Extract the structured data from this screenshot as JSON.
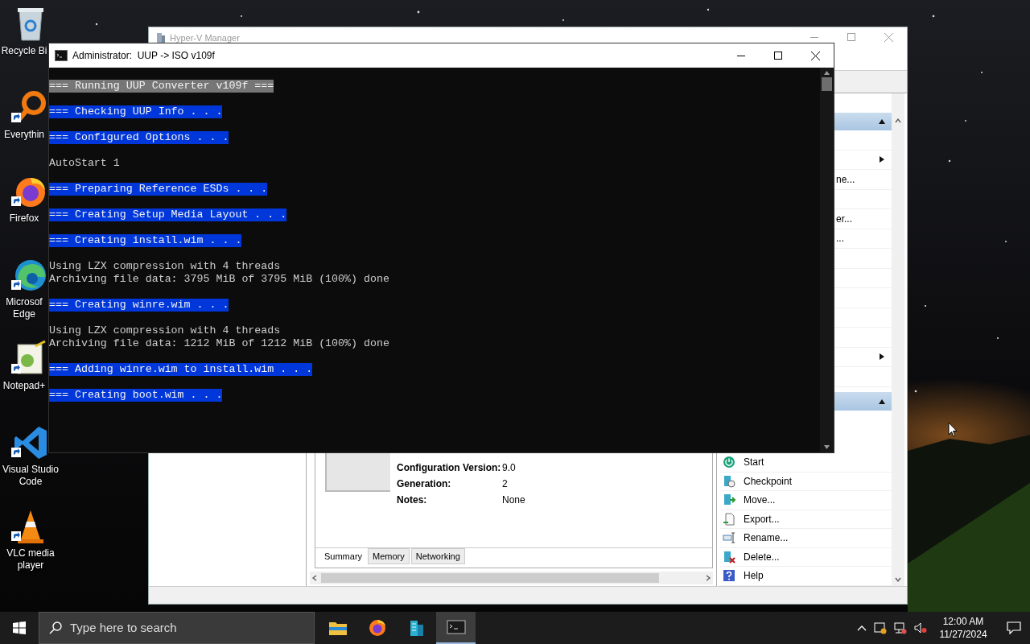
{
  "desktop_icons": [
    {
      "label": "Recycle Bi",
      "kind": "recycle-bin",
      "shortcut": false
    },
    {
      "label": "Everythin",
      "kind": "magnifier",
      "shortcut": true
    },
    {
      "label": "Firefox",
      "kind": "firefox",
      "shortcut": true
    },
    {
      "label": "Microsof Edge",
      "kind": "edge",
      "shortcut": true
    },
    {
      "label": "Notepad+",
      "kind": "notepad",
      "shortcut": true
    },
    {
      "label": "Visual Studio Code",
      "kind": "vscode",
      "shortcut": true
    },
    {
      "label": "VLC media player",
      "kind": "vlc",
      "shortcut": true
    }
  ],
  "hyperv_window": {
    "title": "Hyper-V Manager",
    "active": false,
    "details": {
      "fields": [
        {
          "label": "Configuration Version:",
          "value": "9.0"
        },
        {
          "label": "Generation:",
          "value": "2"
        },
        {
          "label": "Notes:",
          "value": "None"
        }
      ]
    },
    "detail_tabs": [
      {
        "label": "Summary",
        "selected": true
      },
      {
        "label": "Memory",
        "selected": false
      },
      {
        "label": "Networking",
        "selected": false
      }
    ],
    "actions_sections": [
      {
        "expanded": true,
        "items": [
          {
            "submenu": true
          },
          {
            "label": "ne...",
            "submenu": false
          },
          {
            "label": "er...",
            "submenu": false
          },
          {
            "label": "...",
            "submenu": false
          },
          {
            "submenu": true
          }
        ]
      },
      {
        "expanded": true,
        "items": [
          {
            "label": "Start",
            "kind": "start"
          },
          {
            "label": "Checkpoint",
            "kind": "checkpoint"
          },
          {
            "label": "Move...",
            "kind": "move"
          },
          {
            "label": "Export...",
            "kind": "export"
          },
          {
            "label": "Rename...",
            "kind": "rename"
          },
          {
            "label": "Delete...",
            "kind": "delete"
          },
          {
            "label": "Help",
            "kind": "help"
          }
        ]
      }
    ]
  },
  "console_window": {
    "title": "Administrator:  UUP -> ISO v109f",
    "blocks": [
      {
        "color": "#767676",
        "lines": [
          "=== Running UUP Converter v109f ==="
        ]
      },
      {
        "color": "#0037da",
        "lines": [
          "=== Checking UUP Info . . ."
        ]
      },
      {
        "color": "#0037da",
        "lines": [
          "=== Configured Options . . ."
        ]
      },
      {
        "lines": [
          "AutoStart 1"
        ]
      },
      {
        "color": "#0037da",
        "lines": [
          "=== Preparing Reference ESDs . . ."
        ]
      },
      {
        "color": "#0037da",
        "lines": [
          "=== Creating Setup Media Layout . . ."
        ]
      },
      {
        "color": "#0037da",
        "lines": [
          "=== Creating install.wim . . ."
        ]
      },
      {
        "lines": [
          "Using LZX compression with 4 threads",
          "Archiving file data: 3795 MiB of 3795 MiB (100%) done"
        ]
      },
      {
        "color": "#0037da",
        "lines": [
          "=== Creating winre.wim . . ."
        ]
      },
      {
        "lines": [
          "Using LZX compression with 4 threads",
          "Archiving file data: 1212 MiB of 1212 MiB (100%) done"
        ]
      },
      {
        "color": "#0037da",
        "lines": [
          "=== Adding winre.wim to install.wim . . ."
        ]
      },
      {
        "color": "#0037da",
        "lines": [
          "=== Creating boot.wim . . ."
        ]
      }
    ]
  },
  "taskbar": {
    "search": {
      "placeholder": "Type here to search"
    },
    "apps": [
      {
        "kind": "file-explorer",
        "active": false
      },
      {
        "kind": "firefox",
        "active": false
      },
      {
        "kind": "hyper-v",
        "active": false
      },
      {
        "kind": "terminal",
        "active": true
      }
    ],
    "clock": {
      "time": "12:00 AM",
      "date": "11/27/2024"
    }
  }
}
